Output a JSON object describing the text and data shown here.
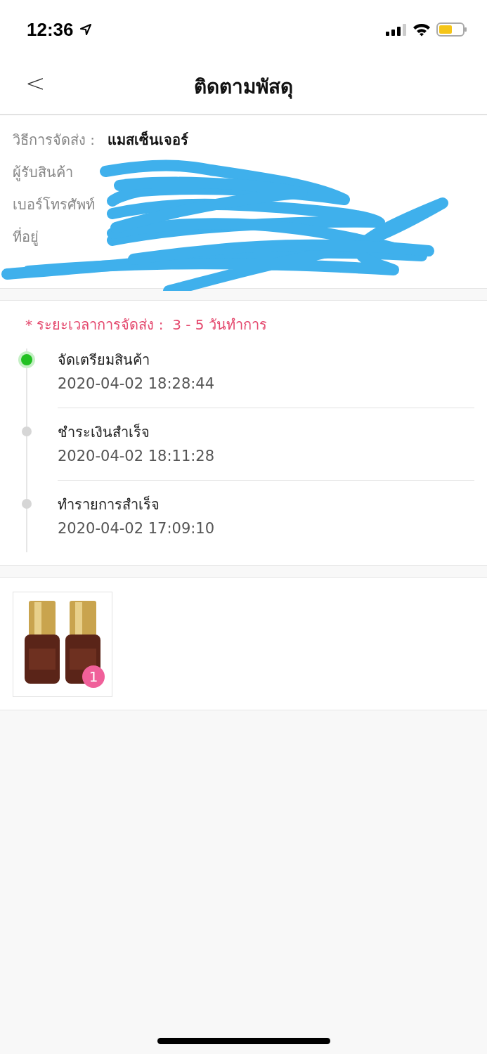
{
  "status_bar": {
    "time": "12:36"
  },
  "nav": {
    "back": "<",
    "title": "ติดตามพัสดุ"
  },
  "shipping_info": [
    {
      "label": "วิธีการจัดส่ง :",
      "value": "แมสเซ็นเจอร์"
    },
    {
      "label": "ผู้รับสินค้า"
    },
    {
      "label": "เบอร์โทรศัพท์"
    },
    {
      "label": "ที่อยู่"
    }
  ],
  "delivery_time": {
    "label": "* ระยะเวลาการจัดส่ง :",
    "value": "3 - 5 วันทำการ"
  },
  "timeline": [
    {
      "title": "จัดเตรียมสินค้า",
      "time": "2020-04-02 18:28:44",
      "active": true
    },
    {
      "title": "ชำระเงินสำเร็จ",
      "time": "2020-04-02 18:11:28",
      "active": false
    },
    {
      "title": "ทำรายการสำเร็จ",
      "time": "2020-04-02 17:09:10",
      "active": false
    }
  ],
  "products": [
    {
      "kind": "picture",
      "badge": "1"
    }
  ]
}
